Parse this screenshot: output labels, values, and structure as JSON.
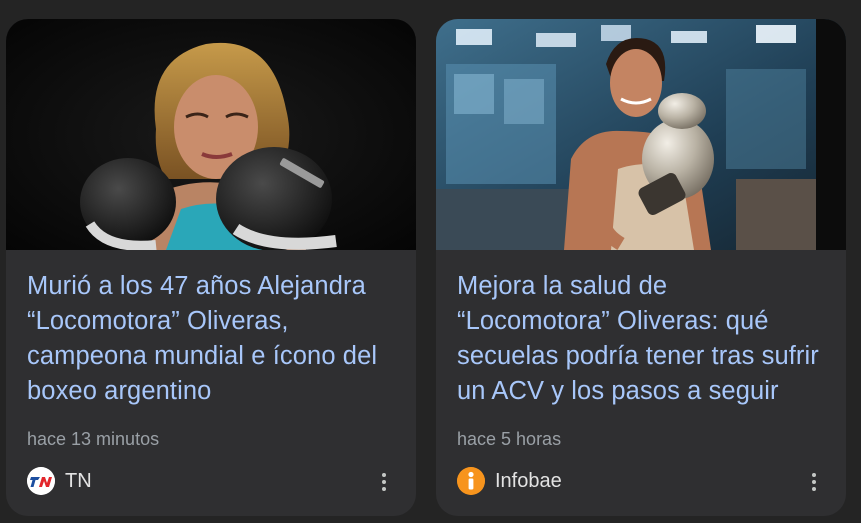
{
  "cards": [
    {
      "headline": "Murió a los 47 años Alejandra “Locomotora” Oliveras, campeona mundial e ícono del boxeo argentino",
      "time": "hace 13 minutos",
      "source": "TN",
      "source_logo": "tn-logo-icon",
      "image": "boxer-photo-black-background"
    },
    {
      "headline": "Mejora la salud de “Locomotora” Oliveras: qué secuelas podría tener tras sufrir un ACV y los pasos a seguir",
      "time": "hace 5 horas",
      "source": "Infobae",
      "source_logo": "infobae-logo-icon",
      "image": "boxer-photo-newsroom"
    }
  ],
  "colors": {
    "page_background": "#242424",
    "card_background": "#2f2f31",
    "headline": "#a8c7fa",
    "meta_text": "#9aa0a6",
    "source_text": "#e3e3e3",
    "infobae_orange": "#f7941d"
  }
}
